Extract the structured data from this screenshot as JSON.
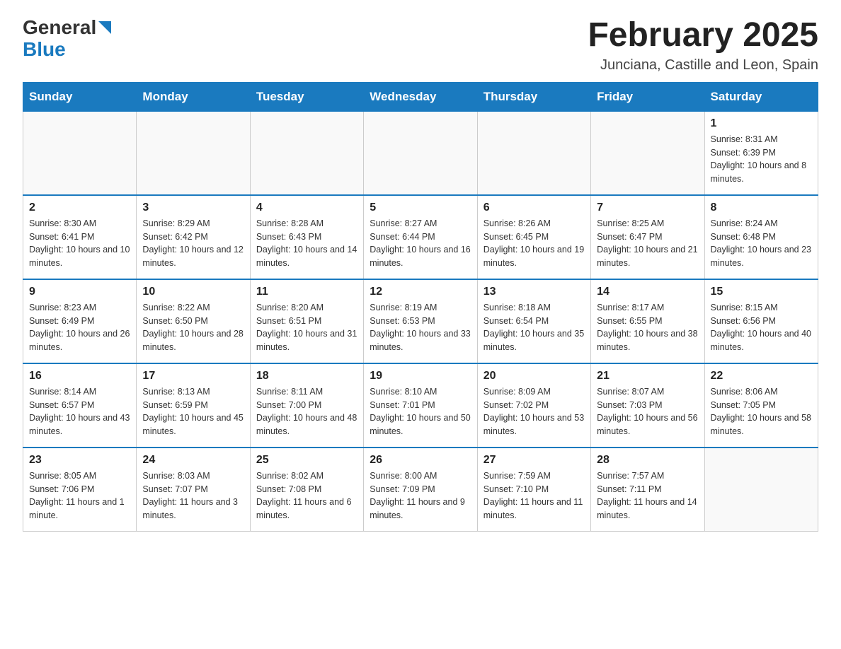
{
  "header": {
    "logo_general": "General",
    "logo_blue": "Blue",
    "month_title": "February 2025",
    "subtitle": "Junciana, Castille and Leon, Spain"
  },
  "days_of_week": [
    "Sunday",
    "Monday",
    "Tuesday",
    "Wednesday",
    "Thursday",
    "Friday",
    "Saturday"
  ],
  "weeks": [
    [
      {
        "day": "",
        "info": ""
      },
      {
        "day": "",
        "info": ""
      },
      {
        "day": "",
        "info": ""
      },
      {
        "day": "",
        "info": ""
      },
      {
        "day": "",
        "info": ""
      },
      {
        "day": "",
        "info": ""
      },
      {
        "day": "1",
        "info": "Sunrise: 8:31 AM\nSunset: 6:39 PM\nDaylight: 10 hours and 8 minutes."
      }
    ],
    [
      {
        "day": "2",
        "info": "Sunrise: 8:30 AM\nSunset: 6:41 PM\nDaylight: 10 hours and 10 minutes."
      },
      {
        "day": "3",
        "info": "Sunrise: 8:29 AM\nSunset: 6:42 PM\nDaylight: 10 hours and 12 minutes."
      },
      {
        "day": "4",
        "info": "Sunrise: 8:28 AM\nSunset: 6:43 PM\nDaylight: 10 hours and 14 minutes."
      },
      {
        "day": "5",
        "info": "Sunrise: 8:27 AM\nSunset: 6:44 PM\nDaylight: 10 hours and 16 minutes."
      },
      {
        "day": "6",
        "info": "Sunrise: 8:26 AM\nSunset: 6:45 PM\nDaylight: 10 hours and 19 minutes."
      },
      {
        "day": "7",
        "info": "Sunrise: 8:25 AM\nSunset: 6:47 PM\nDaylight: 10 hours and 21 minutes."
      },
      {
        "day": "8",
        "info": "Sunrise: 8:24 AM\nSunset: 6:48 PM\nDaylight: 10 hours and 23 minutes."
      }
    ],
    [
      {
        "day": "9",
        "info": "Sunrise: 8:23 AM\nSunset: 6:49 PM\nDaylight: 10 hours and 26 minutes."
      },
      {
        "day": "10",
        "info": "Sunrise: 8:22 AM\nSunset: 6:50 PM\nDaylight: 10 hours and 28 minutes."
      },
      {
        "day": "11",
        "info": "Sunrise: 8:20 AM\nSunset: 6:51 PM\nDaylight: 10 hours and 31 minutes."
      },
      {
        "day": "12",
        "info": "Sunrise: 8:19 AM\nSunset: 6:53 PM\nDaylight: 10 hours and 33 minutes."
      },
      {
        "day": "13",
        "info": "Sunrise: 8:18 AM\nSunset: 6:54 PM\nDaylight: 10 hours and 35 minutes."
      },
      {
        "day": "14",
        "info": "Sunrise: 8:17 AM\nSunset: 6:55 PM\nDaylight: 10 hours and 38 minutes."
      },
      {
        "day": "15",
        "info": "Sunrise: 8:15 AM\nSunset: 6:56 PM\nDaylight: 10 hours and 40 minutes."
      }
    ],
    [
      {
        "day": "16",
        "info": "Sunrise: 8:14 AM\nSunset: 6:57 PM\nDaylight: 10 hours and 43 minutes."
      },
      {
        "day": "17",
        "info": "Sunrise: 8:13 AM\nSunset: 6:59 PM\nDaylight: 10 hours and 45 minutes."
      },
      {
        "day": "18",
        "info": "Sunrise: 8:11 AM\nSunset: 7:00 PM\nDaylight: 10 hours and 48 minutes."
      },
      {
        "day": "19",
        "info": "Sunrise: 8:10 AM\nSunset: 7:01 PM\nDaylight: 10 hours and 50 minutes."
      },
      {
        "day": "20",
        "info": "Sunrise: 8:09 AM\nSunset: 7:02 PM\nDaylight: 10 hours and 53 minutes."
      },
      {
        "day": "21",
        "info": "Sunrise: 8:07 AM\nSunset: 7:03 PM\nDaylight: 10 hours and 56 minutes."
      },
      {
        "day": "22",
        "info": "Sunrise: 8:06 AM\nSunset: 7:05 PM\nDaylight: 10 hours and 58 minutes."
      }
    ],
    [
      {
        "day": "23",
        "info": "Sunrise: 8:05 AM\nSunset: 7:06 PM\nDaylight: 11 hours and 1 minute."
      },
      {
        "day": "24",
        "info": "Sunrise: 8:03 AM\nSunset: 7:07 PM\nDaylight: 11 hours and 3 minutes."
      },
      {
        "day": "25",
        "info": "Sunrise: 8:02 AM\nSunset: 7:08 PM\nDaylight: 11 hours and 6 minutes."
      },
      {
        "day": "26",
        "info": "Sunrise: 8:00 AM\nSunset: 7:09 PM\nDaylight: 11 hours and 9 minutes."
      },
      {
        "day": "27",
        "info": "Sunrise: 7:59 AM\nSunset: 7:10 PM\nDaylight: 11 hours and 11 minutes."
      },
      {
        "day": "28",
        "info": "Sunrise: 7:57 AM\nSunset: 7:11 PM\nDaylight: 11 hours and 14 minutes."
      },
      {
        "day": "",
        "info": ""
      }
    ]
  ]
}
